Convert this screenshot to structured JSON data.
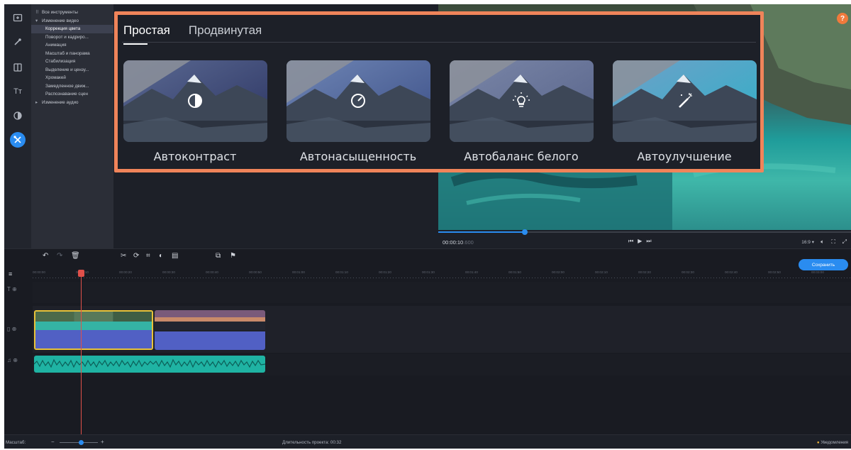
{
  "colors": {
    "accent": "#2a8cf0",
    "highlight_border": "#f0845a",
    "selected_clip_border": "#e8c23a",
    "playhead": "#e0504a",
    "audio_clip": "#1fb3a3",
    "clip_audio_track": "#5160c4"
  },
  "rail": {
    "items": [
      {
        "name": "import-icon",
        "active": false
      },
      {
        "name": "wand-icon",
        "active": false
      },
      {
        "name": "transitions-icon",
        "active": false
      },
      {
        "name": "titles-icon",
        "active": false,
        "text": "Tт"
      },
      {
        "name": "filters-icon",
        "active": false
      },
      {
        "name": "tools-icon",
        "active": true
      }
    ]
  },
  "tree": {
    "items": [
      {
        "label": "Все инструменты",
        "level": 0,
        "marker": "⠿"
      },
      {
        "label": "Изменение видео",
        "level": 0,
        "marker": "▾"
      },
      {
        "label": "Коррекция цвета",
        "level": 1,
        "selected": true
      },
      {
        "label": "Поворот и кадриро...",
        "level": 1
      },
      {
        "label": "Анимация",
        "level": 1
      },
      {
        "label": "Масштаб и панорама",
        "level": 1
      },
      {
        "label": "Стабилизация",
        "level": 1
      },
      {
        "label": "Выделение и цензу...",
        "level": 1
      },
      {
        "label": "Хромакей",
        "level": 1
      },
      {
        "label": "Замедленное движ...",
        "level": 1
      },
      {
        "label": "Распознавание сцен",
        "level": 1
      },
      {
        "label": "Изменение аудио",
        "level": 0,
        "marker": "▸"
      }
    ]
  },
  "color_panel": {
    "tabs": [
      {
        "label": "Простая",
        "active": true
      },
      {
        "label": "Продвинутая",
        "active": false
      }
    ],
    "cards": [
      {
        "label": "Автоконтраст",
        "icon": "contrast-icon"
      },
      {
        "label": "Автонасыщенность",
        "icon": "saturation-icon"
      },
      {
        "label": "Автобаланс белого",
        "icon": "white-balance-icon"
      },
      {
        "label": "Автоулучшение",
        "icon": "magic-wand-icon"
      }
    ]
  },
  "player": {
    "help": "?",
    "timecode": "00:00:10",
    "timecode_ms": ".600",
    "aspect": "16:9 ▾",
    "progress": 0.21
  },
  "timeline": {
    "save_label": "Сохранить",
    "ruler_ticks": [
      "00:00:00",
      "00:00:10",
      "00:00:20",
      "00:00:30",
      "00:00:40",
      "00:00:50",
      "00:01:00",
      "00:01:10",
      "00:01:20",
      "00:01:30",
      "00:01:40",
      "00:01:50",
      "00:02:00",
      "00:02:10",
      "00:02:20",
      "00:02:30",
      "00:02:40",
      "00:02:50",
      "00:03:00"
    ]
  },
  "status": {
    "zoom_label": "Масштаб:",
    "zoom_minus": "−",
    "zoom_plus": "+",
    "zoom_level": 0.55,
    "duration": "Длительность проекта: 00:32",
    "notifications": "Уведомления"
  }
}
